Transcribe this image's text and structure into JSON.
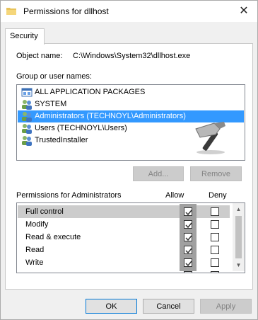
{
  "window": {
    "title": "Permissions for dllhost",
    "close_glyph": "✕"
  },
  "tabs": [
    {
      "label": "Security"
    }
  ],
  "object": {
    "label": "Object name:",
    "value": "C:\\Windows\\System32\\dllhost.exe"
  },
  "groups": {
    "label": "Group or user names:",
    "items": [
      {
        "label": "ALL APPLICATION PACKAGES",
        "icon": "app-packages-icon",
        "selected": false
      },
      {
        "label": "SYSTEM",
        "icon": "users-icon",
        "selected": false
      },
      {
        "label": "Administrators (TECHNOYL\\Administrators)",
        "icon": "users-icon",
        "selected": true
      },
      {
        "label": "Users (TECHNOYL\\Users)",
        "icon": "users-icon",
        "selected": false
      },
      {
        "label": "TrustedInstaller",
        "icon": "users-icon",
        "selected": false
      }
    ]
  },
  "buttons": {
    "add": "Add...",
    "remove": "Remove",
    "ok": "OK",
    "cancel": "Cancel",
    "apply": "Apply"
  },
  "permissions": {
    "label": "Permissions for Administrators",
    "allow_label": "Allow",
    "deny_label": "Deny",
    "rows": [
      {
        "name": "Full control",
        "allow": true,
        "deny": false,
        "selected": true
      },
      {
        "name": "Modify",
        "allow": true,
        "deny": false,
        "selected": false
      },
      {
        "name": "Read & execute",
        "allow": true,
        "deny": false,
        "selected": false
      },
      {
        "name": "Read",
        "allow": true,
        "deny": false,
        "selected": false
      },
      {
        "name": "Write",
        "allow": true,
        "deny": false,
        "selected": false
      }
    ]
  },
  "colors": {
    "selection": "#3399ff",
    "default_button_border": "#0078d7"
  }
}
